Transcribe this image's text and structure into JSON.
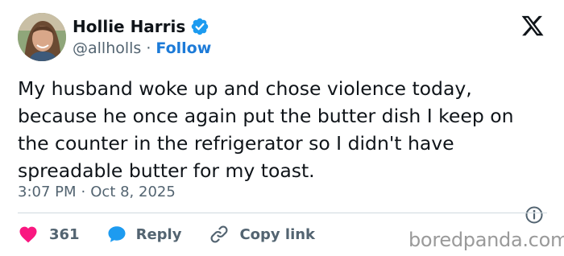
{
  "author": {
    "name": "Hollie Harris",
    "handle": "@allholls",
    "separator": "·",
    "follow_label": "Follow"
  },
  "tweet": {
    "text": "My husband woke up and chose violence today, because he once again put the butter dish I keep on the counter in the refrigerator so I didn't have spreadable butter for my toast.",
    "time": "3:07 PM",
    "separator": "·",
    "date": "Oct 8, 2025"
  },
  "actions": {
    "like_count": "361",
    "reply_label": "Reply",
    "copy_label": "Copy link"
  },
  "watermark": "boredpanda.com",
  "icons": {
    "logo": "x-logo-icon",
    "verified": "verified-badge-icon",
    "like": "heart-icon",
    "reply": "speech-bubble-icon",
    "copy": "link-icon",
    "info": "info-icon"
  },
  "colors": {
    "text": "#0f1419",
    "secondary": "#536471",
    "follow": "#1d7bd8",
    "verified": "#1d9bf0",
    "like": "#f91880",
    "reply": "#1d9bf0",
    "divider": "#cfd9de"
  }
}
